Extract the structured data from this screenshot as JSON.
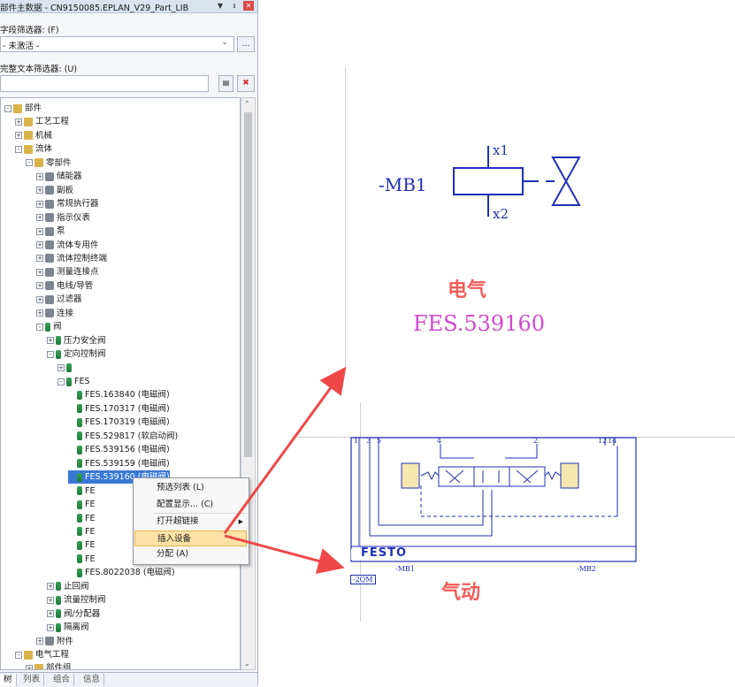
{
  "panel": {
    "title": "部件主数据 - CN9150085.EPLAN_V29_Part_LIB",
    "field_filter_label": "字段筛选器: (F)",
    "field_filter_value": "- 未激活 -",
    "text_filter_label": "完整文本筛选器: (U)",
    "text_filter_value": "",
    "tree": [
      {
        "label": "部件",
        "level": 0,
        "expand": "-",
        "icon": "folder"
      },
      {
        "label": "工艺工程",
        "level": 1,
        "expand": "+",
        "icon": "folder"
      },
      {
        "label": "机械",
        "level": 1,
        "expand": "+",
        "icon": "folder"
      },
      {
        "label": "流体",
        "level": 1,
        "expand": "-",
        "icon": "folder"
      },
      {
        "label": "零部件",
        "level": 2,
        "expand": "-",
        "icon": "folder"
      },
      {
        "label": "储能器",
        "level": 3,
        "expand": "+",
        "icon": "gray"
      },
      {
        "label": "副板",
        "level": 3,
        "expand": "+",
        "icon": "gray"
      },
      {
        "label": "常规执行器",
        "level": 3,
        "expand": "+",
        "icon": "gray"
      },
      {
        "label": "指示仪表",
        "level": 3,
        "expand": "+",
        "icon": "gray"
      },
      {
        "label": "泵",
        "level": 3,
        "expand": "+",
        "icon": "gray"
      },
      {
        "label": "流体专用件",
        "level": 3,
        "expand": "+",
        "icon": "gray"
      },
      {
        "label": "流体控制终端",
        "level": 3,
        "expand": "+",
        "icon": "gray"
      },
      {
        "label": "测量连接点",
        "level": 3,
        "expand": "+",
        "icon": "gray"
      },
      {
        "label": "电线/导管",
        "level": 3,
        "expand": "+",
        "icon": "gray"
      },
      {
        "label": "过滤器",
        "level": 3,
        "expand": "+",
        "icon": "gray"
      },
      {
        "label": "连接",
        "level": 3,
        "expand": "+",
        "icon": "gray"
      },
      {
        "label": "阀",
        "level": 3,
        "expand": "-",
        "icon": "valve"
      },
      {
        "label": "压力安全阀",
        "level": 4,
        "expand": "+",
        "icon": "valve"
      },
      {
        "label": "定向控制阀",
        "level": 4,
        "expand": "-",
        "icon": "valve"
      },
      {
        "label": "",
        "level": 5,
        "expand": "+",
        "icon": "valve"
      },
      {
        "label": "FES",
        "level": 5,
        "expand": "-",
        "icon": "valve"
      },
      {
        "label": "FES.163840 (电磁阀)",
        "level": 6,
        "expand": "",
        "icon": "valve"
      },
      {
        "label": "FES.170317 (电磁阀)",
        "level": 6,
        "expand": "",
        "icon": "valve"
      },
      {
        "label": "FES.170319 (电磁阀)",
        "level": 6,
        "expand": "",
        "icon": "valve"
      },
      {
        "label": "FES.529817 (软启动阀)",
        "level": 6,
        "expand": "",
        "icon": "valve"
      },
      {
        "label": "FES.539156 (电磁阀)",
        "level": 6,
        "expand": "",
        "icon": "valve"
      },
      {
        "label": "FES.539159 (电磁阀)",
        "level": 6,
        "expand": "",
        "icon": "valve"
      },
      {
        "label": "FES.539160 (电磁阀)",
        "level": 6,
        "expand": "",
        "icon": "valve",
        "selected": true
      },
      {
        "label": "FE",
        "level": 6,
        "expand": "",
        "icon": "valve"
      },
      {
        "label": "FE",
        "level": 6,
        "expand": "",
        "icon": "valve"
      },
      {
        "label": "FE",
        "level": 6,
        "expand": "",
        "icon": "valve"
      },
      {
        "label": "FE",
        "level": 6,
        "expand": "",
        "icon": "valve"
      },
      {
        "label": "FE",
        "level": 6,
        "expand": "",
        "icon": "valve"
      },
      {
        "label": "FE",
        "level": 6,
        "expand": "",
        "icon": "valve"
      },
      {
        "label": "FES.8022038 (电磁阀)",
        "level": 6,
        "expand": "",
        "icon": "valve"
      },
      {
        "label": "止回阀",
        "level": 4,
        "expand": "+",
        "icon": "valve"
      },
      {
        "label": "流量控制阀",
        "level": 4,
        "expand": "+",
        "icon": "valve"
      },
      {
        "label": "阀/分配器",
        "level": 4,
        "expand": "+",
        "icon": "valve"
      },
      {
        "label": "隔离阀",
        "level": 4,
        "expand": "+",
        "icon": "valve"
      },
      {
        "label": "附件",
        "level": 3,
        "expand": "+",
        "icon": "gray"
      },
      {
        "label": "电气工程",
        "level": 1,
        "expand": "-",
        "icon": "folder"
      },
      {
        "label": "部件组",
        "level": 2,
        "expand": "+",
        "icon": "folder"
      }
    ],
    "tabs": [
      "树",
      "列表",
      "组合",
      "信息"
    ]
  },
  "context_menu": {
    "items": [
      {
        "label": "预选列表 (L)"
      },
      {
        "label": "配置显示... (C)"
      },
      {
        "label": "打开超链接",
        "submenu": true
      },
      {
        "label": "插入设备",
        "highlight": true
      },
      {
        "label": "分配 (A)"
      }
    ]
  },
  "electrical": {
    "device_tag": "-MB1",
    "pin1": "x1",
    "pin2": "x2",
    "caption": "电气",
    "part_no": "FES.539160"
  },
  "pneumatic": {
    "ports": [
      "1",
      "3",
      "5",
      "4",
      "2",
      "12",
      "14"
    ],
    "brand": "FESTO",
    "mb1": "-MB1",
    "mb2": "-MB2",
    "tag": "-2QM",
    "caption": "气动"
  },
  "colors": {
    "accent": "#3878d6",
    "cad_blue": "#2030b8",
    "arrow": "#f04848"
  }
}
